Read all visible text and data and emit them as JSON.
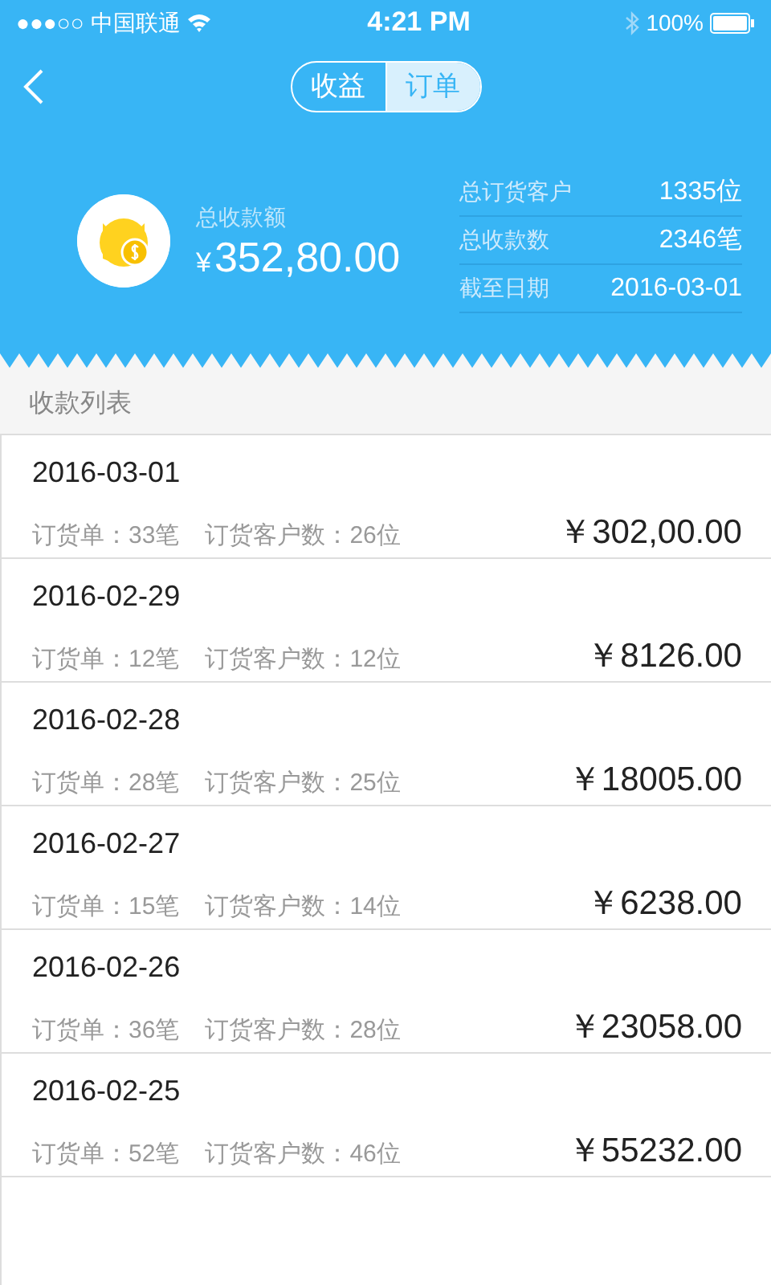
{
  "status_bar": {
    "signal": "●●●○○",
    "carrier": "中国联通",
    "time": "4:21 PM",
    "battery": "100%"
  },
  "segmented": [
    {
      "label": "收益",
      "selected": false
    },
    {
      "label": "订单",
      "selected": true
    }
  ],
  "summary": {
    "label": "总收款额",
    "currency": "¥",
    "amount": "352,80.00",
    "stats": [
      {
        "label": "总订货客户",
        "value": "1335位"
      },
      {
        "label": "总收款数",
        "value": "2346笔"
      },
      {
        "label": "截至日期",
        "value": "2016-03-01"
      }
    ]
  },
  "list_title": "收款列表",
  "payments": [
    {
      "date": "2016-03-01",
      "orders": "订货单：33笔",
      "customers": "订货客户数：26位",
      "amount": "￥302,00.00"
    },
    {
      "date": "2016-02-29",
      "orders": "订货单：12笔",
      "customers": "订货客户数：12位",
      "amount": "￥8126.00"
    },
    {
      "date": "2016-02-28",
      "orders": "订货单：28笔",
      "customers": "订货客户数：25位",
      "amount": "￥18005.00"
    },
    {
      "date": "2016-02-27",
      "orders": "订货单：15笔",
      "customers": "订货客户数：14位",
      "amount": "￥6238.00"
    },
    {
      "date": "2016-02-26",
      "orders": "订货单：36笔",
      "customers": "订货客户数：28位",
      "amount": "￥23058.00"
    },
    {
      "date": "2016-02-25",
      "orders": "订货单：52笔",
      "customers": "订货客户数：46位",
      "amount": "￥55232.00"
    }
  ]
}
